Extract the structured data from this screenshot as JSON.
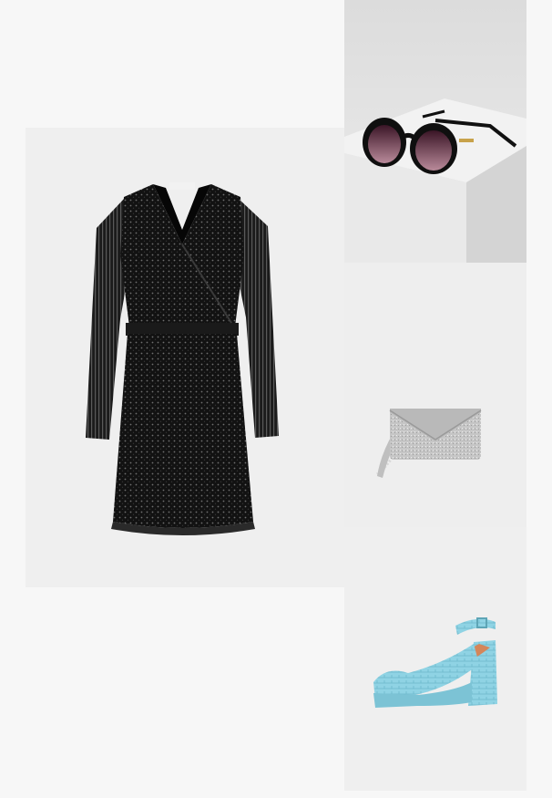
{
  "products": [
    {
      "id": "dress",
      "category": "sequin-wrap-dress",
      "color": "#0d0d0d"
    },
    {
      "id": "sunglasses",
      "category": "cat-eye-sunglasses",
      "color": "#111111"
    },
    {
      "id": "clutch",
      "category": "glitter-envelope-clutch",
      "color": "#c9c9c9"
    },
    {
      "id": "shoe",
      "category": "platform-slingback-pump",
      "color": "#8fd3e4"
    }
  ]
}
